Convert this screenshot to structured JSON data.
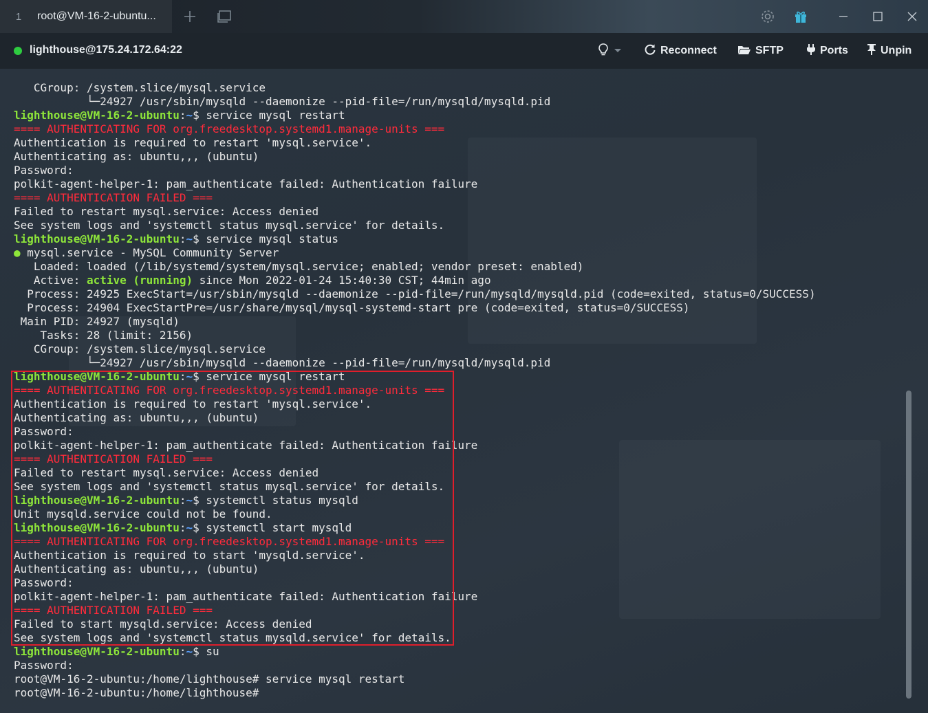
{
  "tab": {
    "number": "1",
    "title": "root@VM-16-2-ubuntu..."
  },
  "toolbar": {
    "new_tab_icon": "plus-icon",
    "layout_icon": "window-icon",
    "settings_icon": "gear-icon",
    "gift_icon": "gift-icon"
  },
  "status": {
    "connection": "lighthouse@175.24.172.64:22",
    "connection_color": "#2ecc40",
    "reconnect_label": "Reconnect",
    "sftp_label": "SFTP",
    "ports_label": "Ports",
    "unpin_label": "Unpin"
  },
  "colors": {
    "prompt": "#8ee63a",
    "path": "#5aa0ff",
    "error": "#ff2b3b",
    "highlight_border": "#e01e2b"
  },
  "terminal": {
    "lines": [
      [
        {
          "t": "   CGroup: /system.slice/mysql.service",
          "c": ""
        }
      ],
      [
        {
          "t": "           └─24927 /usr/sbin/mysqld --daemonize --pid-file=/run/mysqld/mysqld.pid",
          "c": ""
        }
      ],
      [
        {
          "t": "lighthouse@VM-16-2-ubuntu",
          "c": "prompt"
        },
        {
          "t": ":",
          "c": ""
        },
        {
          "t": "~",
          "c": "tilde"
        },
        {
          "t": "$ service mysql restart",
          "c": ""
        }
      ],
      [
        {
          "t": "==== AUTHENTICATING FOR org.freedesktop.systemd1.manage-units ===",
          "c": "red"
        }
      ],
      [
        {
          "t": "Authentication is required to restart 'mysql.service'.",
          "c": ""
        }
      ],
      [
        {
          "t": "Authenticating as: ubuntu,,, (ubuntu)",
          "c": ""
        }
      ],
      [
        {
          "t": "Password:",
          "c": ""
        }
      ],
      [
        {
          "t": "polkit-agent-helper-1: pam_authenticate failed: Authentication failure",
          "c": ""
        }
      ],
      [
        {
          "t": "==== AUTHENTICATION FAILED ===",
          "c": "red"
        }
      ],
      [
        {
          "t": "Failed to restart mysql.service: Access denied",
          "c": ""
        }
      ],
      [
        {
          "t": "See system logs and 'systemctl status mysql.service' for details.",
          "c": ""
        }
      ],
      [
        {
          "t": "lighthouse@VM-16-2-ubuntu",
          "c": "prompt"
        },
        {
          "t": ":",
          "c": ""
        },
        {
          "t": "~",
          "c": "tilde"
        },
        {
          "t": "$ service mysql status",
          "c": ""
        }
      ],
      [
        {
          "t": "●",
          "c": "dot-green"
        },
        {
          "t": " mysql.service - MySQL Community Server",
          "c": ""
        }
      ],
      [
        {
          "t": "   Loaded: loaded (/lib/systemd/system/mysql.service; enabled; vendor preset: enabled)",
          "c": ""
        }
      ],
      [
        {
          "t": "   Active: ",
          "c": ""
        },
        {
          "t": "active (running)",
          "c": "green"
        },
        {
          "t": " since Mon 2022-01-24 15:40:30 CST; 44min ago",
          "c": ""
        }
      ],
      [
        {
          "t": "  Process: 24925 ExecStart=/usr/sbin/mysqld --daemonize --pid-file=/run/mysqld/mysqld.pid (code=exited, status=0/SUCCESS)",
          "c": ""
        }
      ],
      [
        {
          "t": "  Process: 24904 ExecStartPre=/usr/share/mysql/mysql-systemd-start pre (code=exited, status=0/SUCCESS)",
          "c": ""
        }
      ],
      [
        {
          "t": " Main PID: 24927 (mysqld)",
          "c": ""
        }
      ],
      [
        {
          "t": "    Tasks: 28 (limit: 2156)",
          "c": ""
        }
      ],
      [
        {
          "t": "   CGroup: /system.slice/mysql.service",
          "c": ""
        }
      ],
      [
        {
          "t": "           └─24927 /usr/sbin/mysqld --daemonize --pid-file=/run/mysqld/mysqld.pid",
          "c": ""
        }
      ],
      [
        {
          "t": "lighthouse@VM-16-2-ubuntu",
          "c": "prompt"
        },
        {
          "t": ":",
          "c": ""
        },
        {
          "t": "~",
          "c": "tilde"
        },
        {
          "t": "$ service mysql restart",
          "c": ""
        }
      ],
      [
        {
          "t": "==== AUTHENTICATING FOR org.freedesktop.systemd1.manage-units ===",
          "c": "red"
        }
      ],
      [
        {
          "t": "Authentication is required to restart 'mysql.service'.",
          "c": ""
        }
      ],
      [
        {
          "t": "Authenticating as: ubuntu,,, (ubuntu)",
          "c": ""
        }
      ],
      [
        {
          "t": "Password:",
          "c": ""
        }
      ],
      [
        {
          "t": "polkit-agent-helper-1: pam_authenticate failed: Authentication failure",
          "c": ""
        }
      ],
      [
        {
          "t": "==== AUTHENTICATION FAILED ===",
          "c": "red"
        }
      ],
      [
        {
          "t": "Failed to restart mysql.service: Access denied",
          "c": ""
        }
      ],
      [
        {
          "t": "See system logs and 'systemctl status mysql.service' for details.",
          "c": ""
        }
      ],
      [
        {
          "t": "lighthouse@VM-16-2-ubuntu",
          "c": "prompt"
        },
        {
          "t": ":",
          "c": ""
        },
        {
          "t": "~",
          "c": "tilde"
        },
        {
          "t": "$ systemctl status mysqld",
          "c": ""
        }
      ],
      [
        {
          "t": "Unit mysqld.service could not be found.",
          "c": ""
        }
      ],
      [
        {
          "t": "lighthouse@VM-16-2-ubuntu",
          "c": "prompt"
        },
        {
          "t": ":",
          "c": ""
        },
        {
          "t": "~",
          "c": "tilde"
        },
        {
          "t": "$ systemctl start mysqld",
          "c": ""
        }
      ],
      [
        {
          "t": "==== AUTHENTICATING FOR org.freedesktop.systemd1.manage-units ===",
          "c": "red"
        }
      ],
      [
        {
          "t": "Authentication is required to start 'mysqld.service'.",
          "c": ""
        }
      ],
      [
        {
          "t": "Authenticating as: ubuntu,,, (ubuntu)",
          "c": ""
        }
      ],
      [
        {
          "t": "Password:",
          "c": ""
        }
      ],
      [
        {
          "t": "polkit-agent-helper-1: pam_authenticate failed: Authentication failure",
          "c": ""
        }
      ],
      [
        {
          "t": "==== AUTHENTICATION FAILED ===",
          "c": "red"
        }
      ],
      [
        {
          "t": "Failed to start mysqld.service: Access denied",
          "c": ""
        }
      ],
      [
        {
          "t": "See system logs and 'systemctl status mysqld.service' for details.",
          "c": ""
        }
      ],
      [
        {
          "t": "lighthouse@VM-16-2-ubuntu",
          "c": "prompt"
        },
        {
          "t": ":",
          "c": ""
        },
        {
          "t": "~",
          "c": "tilde"
        },
        {
          "t": "$ su",
          "c": ""
        }
      ],
      [
        {
          "t": "Password:",
          "c": ""
        }
      ],
      [
        {
          "t": "root@VM-16-2-ubuntu:/home/lighthouse# service mysql restart",
          "c": ""
        }
      ],
      [
        {
          "t": "root@VM-16-2-ubuntu:/home/lighthouse# ",
          "c": ""
        }
      ]
    ]
  }
}
